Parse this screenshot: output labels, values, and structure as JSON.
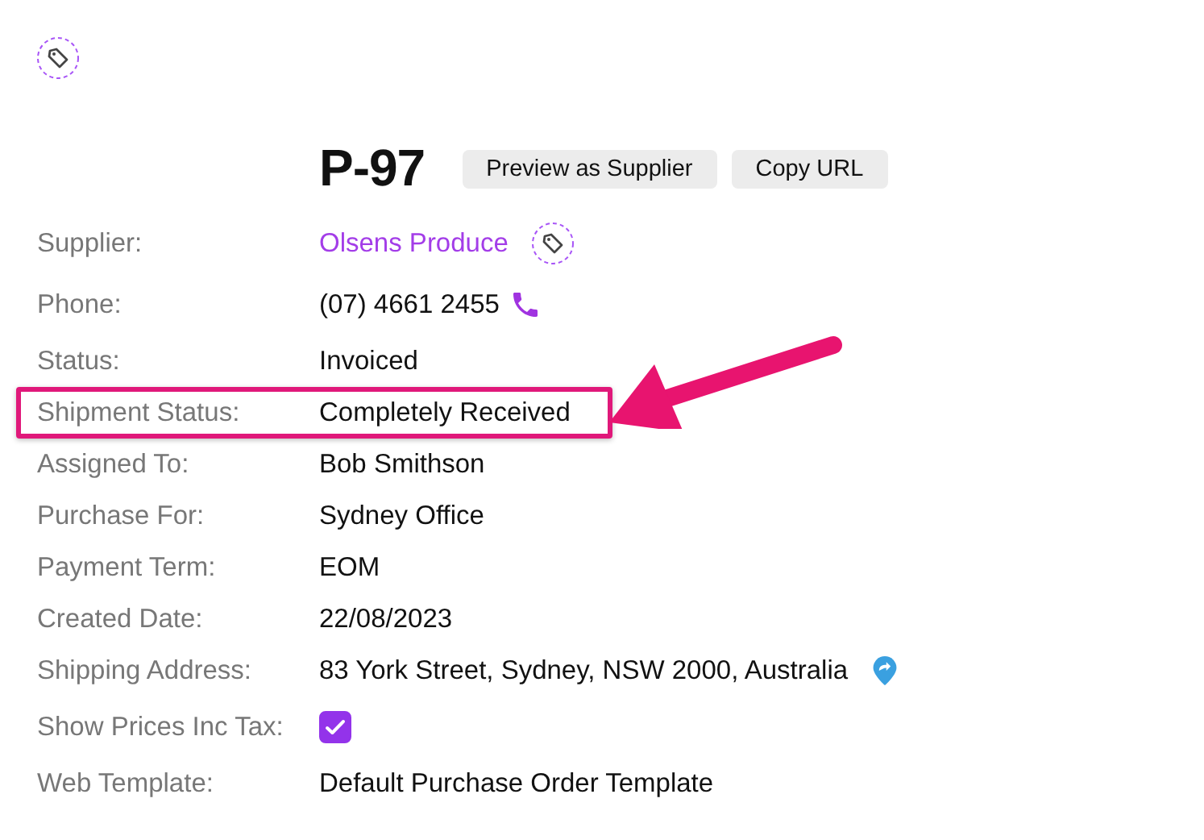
{
  "order": {
    "number": "P-97",
    "buttons": [
      "Preview as Supplier",
      "Copy URL"
    ]
  },
  "fields": [
    {
      "label": "Supplier:",
      "value": "Olsens Produce",
      "kind": "link",
      "highlighted": false
    },
    {
      "label": "Phone:",
      "value": "(07) 4661 2455",
      "kind": "phone",
      "highlighted": false
    },
    {
      "label": "Status:",
      "value": "Invoiced",
      "kind": "text",
      "highlighted": false
    },
    {
      "label": "Shipment Status:",
      "value": "Completely Received",
      "kind": "text",
      "highlighted": true
    },
    {
      "label": "Assigned To:",
      "value": "Bob Smithson",
      "kind": "text",
      "highlighted": false
    },
    {
      "label": "Purchase For:",
      "value": "Sydney Office",
      "kind": "text",
      "highlighted": false
    },
    {
      "label": "Payment Term:",
      "value": "EOM",
      "kind": "text",
      "highlighted": false
    },
    {
      "label": "Created Date:",
      "value": "22/08/2023",
      "kind": "text",
      "highlighted": false
    },
    {
      "label": "Shipping Address:",
      "value": "83 York Street, Sydney, NSW 2000, Australia",
      "kind": "address",
      "highlighted": false
    },
    {
      "label": "Show Prices Inc Tax:",
      "checked": true,
      "kind": "checkbox",
      "highlighted": false
    },
    {
      "label": "Web Template:",
      "value": "Default Purchase Order Template",
      "kind": "text",
      "highlighted": false
    }
  ]
}
